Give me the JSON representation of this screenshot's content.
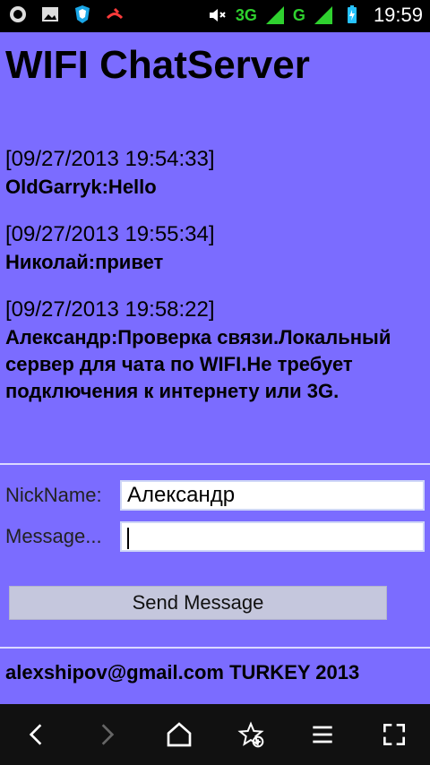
{
  "status_bar": {
    "left_icons": [
      "android-debug-icon",
      "image-icon",
      "shield-icon",
      "missed-call-icon"
    ],
    "right": {
      "network1": "3G",
      "network2": "G",
      "time": "19:59"
    }
  },
  "app": {
    "title": "WIFI ChatServer",
    "messages": [
      {
        "time": "[09/27/2013 19:54:33]",
        "text": "OldGarryk:Hello"
      },
      {
        "time": "[09/27/2013 19:55:34]",
        "text": "Николай:привет"
      },
      {
        "time": "[09/27/2013 19:58:22]",
        "text": "Александр:Проверка связи.Локальный сервер для чата по WIFI.Не требует подключения к интернету или 3G."
      }
    ],
    "form": {
      "nick_label": "NickName:",
      "nick_value": "Александр",
      "message_label": "Message...",
      "message_value": ""
    },
    "send_label": "Send Message",
    "footer": "alexshipov@gmail.com TURKEY 2013"
  },
  "navigation": {
    "buttons": [
      "back-icon",
      "forward-icon",
      "home-icon",
      "favorite-add-icon",
      "menu-icon",
      "fullscreen-icon"
    ]
  }
}
